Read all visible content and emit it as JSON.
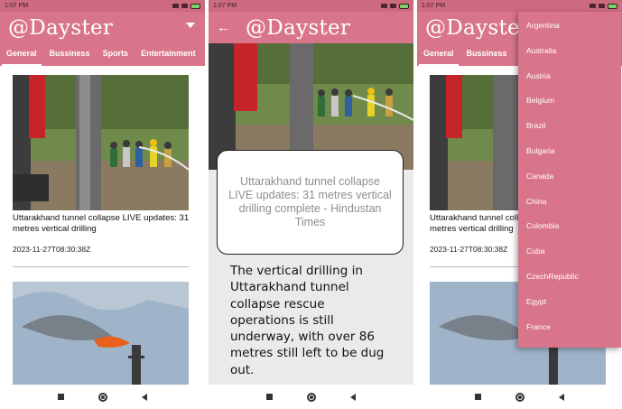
{
  "status": {
    "time": "1:07 PM"
  },
  "app": {
    "title": "@Dayster"
  },
  "tabs": [
    "General",
    "Bussiness",
    "Sports",
    "Entertainment"
  ],
  "articles": [
    {
      "headline": "Uttarakhand tunnel collapse LIVE updates: 31 metres vertical drilling",
      "date": "2023-11-27T08:30:38Z"
    }
  ],
  "detail": {
    "title": "Uttarakhand tunnel collapse LIVE updates: 31 metres vertical drilling complete - Hindustan Times",
    "body": "The vertical drilling in Uttarakhand tunnel collapse rescue operations is still underway, with over 86 metres still left to be dug out."
  },
  "countries": [
    "Argentina",
    "Australia",
    "Austria",
    "Belgium",
    "Brazil",
    "Bulgaria",
    "Canada",
    "China",
    "Colombia",
    "Cuba",
    "CzechRepublic",
    "Egypt",
    "France"
  ],
  "icons": {
    "dropdown": "caret-down-icon",
    "back": "arrow-left-icon",
    "nav": [
      "square-icon",
      "circle-icon",
      "triangle-back-icon"
    ]
  },
  "colors": {
    "primary": "#d9758a",
    "statusbar": "#cc6b80"
  }
}
